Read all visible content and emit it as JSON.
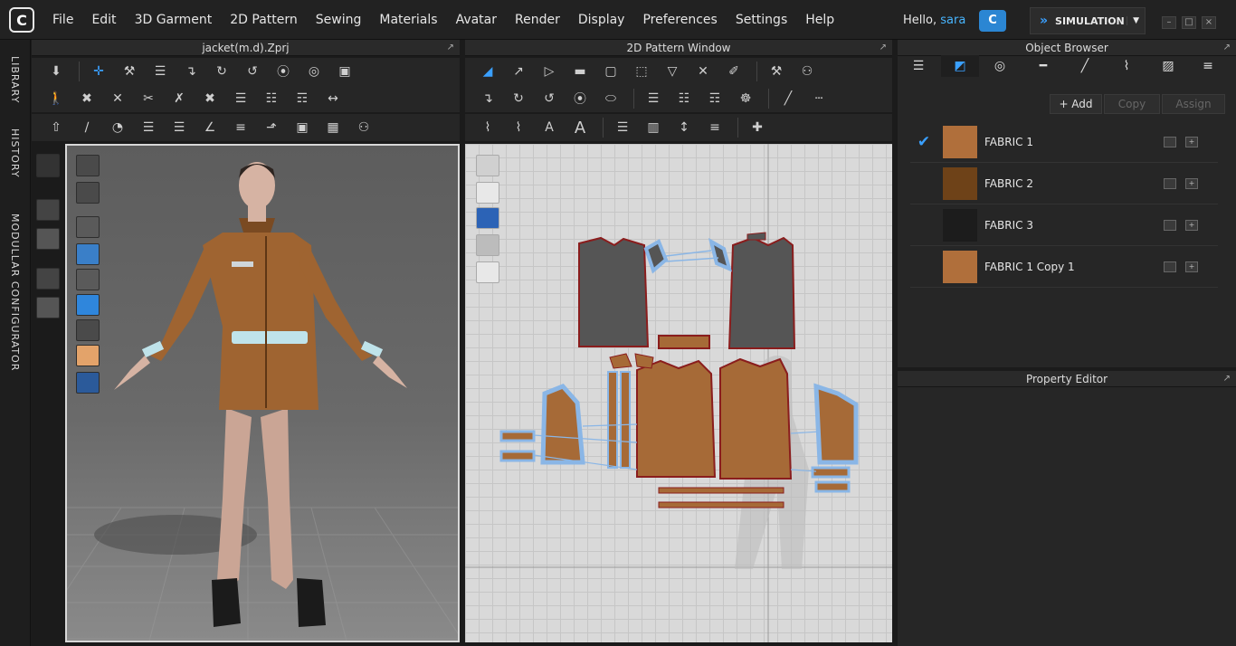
{
  "app": {
    "logo_glyph": "C"
  },
  "menu": [
    "File",
    "Edit",
    "3D Garment",
    "2D Pattern",
    "Sewing",
    "Materials",
    "Avatar",
    "Render",
    "Display",
    "Preferences",
    "Settings",
    "Help"
  ],
  "user": {
    "greeting": "Hello,",
    "name": "sara"
  },
  "cloud": {
    "label": "C"
  },
  "simulation": {
    "label": "SIMULATION"
  },
  "side_tabs": {
    "library": "LIBRARY",
    "history": "HISTORY",
    "modular": "MODULLAR CONFIGURATOR"
  },
  "panels": {
    "view3d_title": "jacket(m.d).Zprj",
    "view2d_title": "2D Pattern Window",
    "object_browser_title": "Object Browser",
    "property_editor_title": "Property Editor"
  },
  "object_browser": {
    "add_label": "+ Add",
    "copy_label": "Copy",
    "assign_label": "Assign",
    "fabrics": [
      {
        "name": "FABRIC 1",
        "color": "#b06f3b",
        "selected": true
      },
      {
        "name": "FABRIC 2",
        "color": "#6e4218",
        "selected": false
      },
      {
        "name": "FABRIC 3",
        "color": "#262626",
        "selected": false
      },
      {
        "name": "FABRIC 1 Copy 1",
        "color": "#b06f3b",
        "selected": false
      }
    ]
  },
  "colors": {
    "accent": "#3aa0ff",
    "garment": "#b06f3b",
    "pattern_outline": "#8ab6e6"
  }
}
